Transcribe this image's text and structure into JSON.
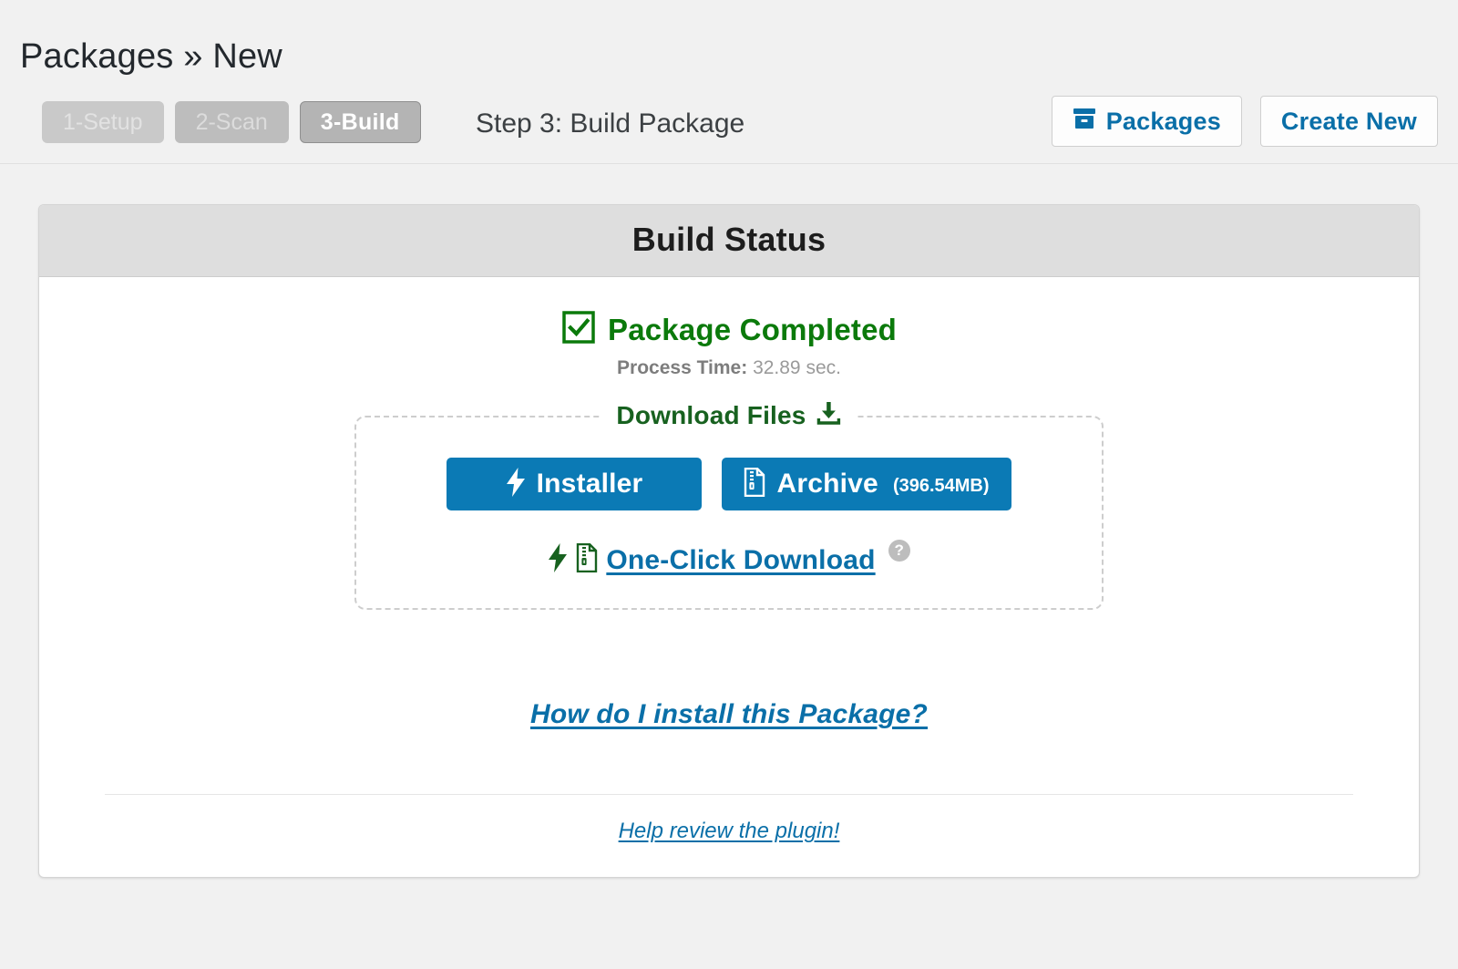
{
  "header": {
    "breadcrumb": "Packages » New"
  },
  "toolbar": {
    "steps": [
      {
        "label": "1-Setup",
        "state": "inactive"
      },
      {
        "label": "2-Scan",
        "state": "inactive"
      },
      {
        "label": "3-Build",
        "state": "active"
      }
    ],
    "step_label": "Step 3: Build Package",
    "packages_button": "Packages",
    "packages_icon": "archive-box-icon",
    "create_new_button": "Create New"
  },
  "card": {
    "title": "Build Status",
    "status": {
      "icon": "checkbox-checked-icon",
      "text": "Package Completed",
      "process_time_label": "Process Time:",
      "process_time_value": "32.89 sec."
    },
    "downloads": {
      "legend": "Download Files",
      "legend_icon": "download-icon",
      "installer": {
        "label": "Installer",
        "icon": "lightning-bolt-icon"
      },
      "archive": {
        "label": "Archive",
        "size": "(396.54MB)",
        "icon": "zip-file-icon"
      },
      "one_click": {
        "label": "One-Click Download",
        "bolt_icon": "lightning-bolt-icon",
        "zip_icon": "zip-file-icon",
        "help_icon": "help-circle-icon",
        "help_glyph": "?"
      }
    },
    "install_link": "How do I install this Package?",
    "review_link": "Help review the plugin!"
  },
  "colors": {
    "accent_blue": "#0b7ab5",
    "link_blue": "#0a6fa8",
    "success_green": "#0b7a0b",
    "legend_green": "#17611f",
    "page_background": "#f1f1f1",
    "card_header": "#dedede"
  }
}
